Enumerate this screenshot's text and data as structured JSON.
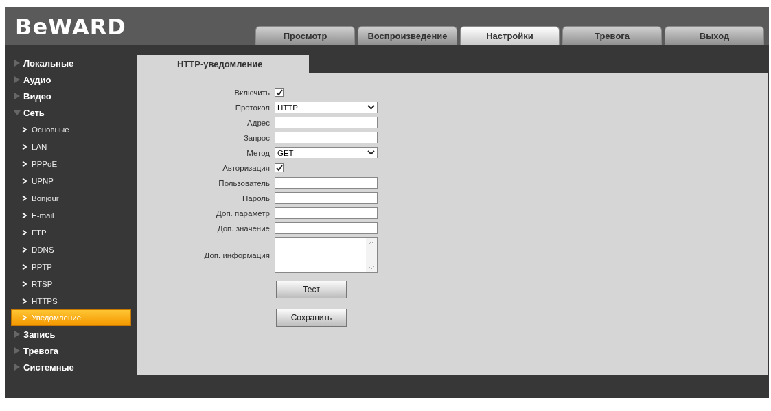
{
  "logo": "BeWARD",
  "tabs": [
    {
      "label": "Просмотр",
      "selected": false
    },
    {
      "label": "Воспроизведение",
      "selected": false
    },
    {
      "label": "Настройки",
      "selected": true
    },
    {
      "label": "Тревога",
      "selected": false
    },
    {
      "label": "Выход",
      "selected": false
    }
  ],
  "sidebar": {
    "items": [
      {
        "label": "Локальные",
        "expanded": false
      },
      {
        "label": "Аудио",
        "expanded": false
      },
      {
        "label": "Видео",
        "expanded": false
      },
      {
        "label": "Сеть",
        "expanded": true,
        "children": [
          {
            "label": "Основные",
            "selected": false
          },
          {
            "label": "LAN",
            "selected": false
          },
          {
            "label": "PPPoE",
            "selected": false
          },
          {
            "label": "UPNP",
            "selected": false
          },
          {
            "label": "Bonjour",
            "selected": false
          },
          {
            "label": "E-mail",
            "selected": false
          },
          {
            "label": "FTP",
            "selected": false
          },
          {
            "label": "DDNS",
            "selected": false
          },
          {
            "label": "PPTP",
            "selected": false
          },
          {
            "label": "RTSP",
            "selected": false
          },
          {
            "label": "HTTPS",
            "selected": false
          },
          {
            "label": "Уведомление",
            "selected": true
          }
        ]
      },
      {
        "label": "Запись",
        "expanded": false
      },
      {
        "label": "Тревога",
        "expanded": false
      },
      {
        "label": "Системные",
        "expanded": false
      }
    ]
  },
  "panel": {
    "tab": "HTTP-уведомление",
    "fields": [
      {
        "kind": "checkbox",
        "label": "Включить",
        "checked": true
      },
      {
        "kind": "select",
        "label": "Протокол",
        "value": "HTTP"
      },
      {
        "kind": "text",
        "label": "Адрес"
      },
      {
        "kind": "text",
        "label": "Запрос"
      },
      {
        "kind": "select",
        "label": "Метод",
        "value": "GET"
      },
      {
        "kind": "checkbox",
        "label": "Авторизация",
        "checked": true
      },
      {
        "kind": "text",
        "label": "Пользователь"
      },
      {
        "kind": "text",
        "label": "Пароль"
      },
      {
        "kind": "text",
        "label": "Доп. параметр"
      },
      {
        "kind": "text",
        "label": "Доп. значение"
      },
      {
        "kind": "textarea",
        "label": "Доп. информация"
      }
    ],
    "buttons": [
      "Тест",
      "Сохранить"
    ]
  }
}
